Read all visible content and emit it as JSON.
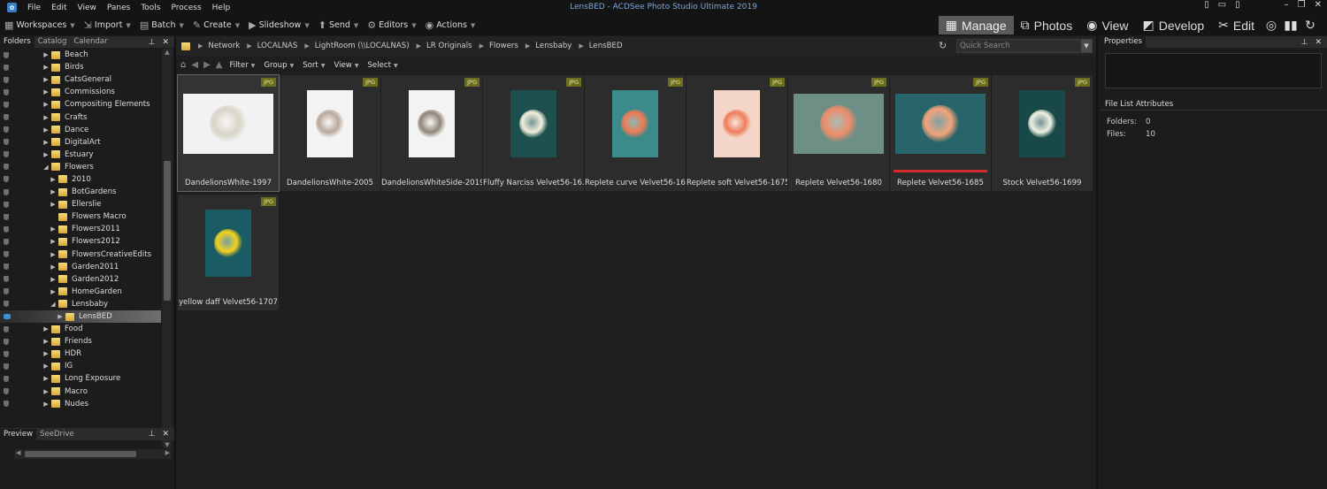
{
  "app": {
    "title": "LensBED - ACDSee Photo Studio Ultimate 2019",
    "menu": [
      "File",
      "Edit",
      "View",
      "Panes",
      "Tools",
      "Process",
      "Help"
    ]
  },
  "toolbar": {
    "items": [
      {
        "label": "Workspaces",
        "icon": "grid-icon"
      },
      {
        "label": "Import",
        "icon": "import-icon"
      },
      {
        "label": "Batch",
        "icon": "batch-icon"
      },
      {
        "label": "Create",
        "icon": "create-icon"
      },
      {
        "label": "Slideshow",
        "icon": "slideshow-icon"
      },
      {
        "label": "Send",
        "icon": "send-icon"
      },
      {
        "label": "Editors",
        "icon": "editors-icon"
      },
      {
        "label": "Actions",
        "icon": "actions-icon"
      }
    ],
    "modes": [
      {
        "label": "Manage",
        "icon": "manage-icon",
        "active": true
      },
      {
        "label": "Photos",
        "icon": "photos-icon",
        "active": false
      },
      {
        "label": "View",
        "icon": "view-icon",
        "active": false
      },
      {
        "label": "Develop",
        "icon": "develop-icon",
        "active": false
      },
      {
        "label": "Edit",
        "icon": "edit-icon",
        "active": false
      }
    ]
  },
  "left_pane": {
    "tabs": [
      "Folders",
      "Catalog",
      "Calendar"
    ],
    "folders": [
      {
        "label": "Beach",
        "depth": 0,
        "arrow": "▶",
        "selected": false
      },
      {
        "label": "Birds",
        "depth": 0,
        "arrow": "▶",
        "selected": false
      },
      {
        "label": "CatsGeneral",
        "depth": 0,
        "arrow": "▶",
        "selected": false
      },
      {
        "label": "Commissions",
        "depth": 0,
        "arrow": "▶",
        "selected": false
      },
      {
        "label": "Compositing Elements",
        "depth": 0,
        "arrow": "▶",
        "selected": false
      },
      {
        "label": "Crafts",
        "depth": 0,
        "arrow": "▶",
        "selected": false
      },
      {
        "label": "Dance",
        "depth": 0,
        "arrow": "▶",
        "selected": false
      },
      {
        "label": "DigitalArt",
        "depth": 0,
        "arrow": "▶",
        "selected": false
      },
      {
        "label": "Estuary",
        "depth": 0,
        "arrow": "▶",
        "selected": false
      },
      {
        "label": "Flowers",
        "depth": 0,
        "arrow": "◢",
        "selected": false
      },
      {
        "label": "2010",
        "depth": 1,
        "arrow": "▶",
        "selected": false
      },
      {
        "label": "BotGardens",
        "depth": 1,
        "arrow": "▶",
        "selected": false
      },
      {
        "label": "Ellerslie",
        "depth": 1,
        "arrow": "▶",
        "selected": false
      },
      {
        "label": "Flowers Macro",
        "depth": 1,
        "arrow": "",
        "selected": false
      },
      {
        "label": "Flowers2011",
        "depth": 1,
        "arrow": "▶",
        "selected": false
      },
      {
        "label": "Flowers2012",
        "depth": 1,
        "arrow": "▶",
        "selected": false
      },
      {
        "label": "FlowersCreativeEdits",
        "depth": 1,
        "arrow": "▶",
        "selected": false
      },
      {
        "label": "Garden2011",
        "depth": 1,
        "arrow": "▶",
        "selected": false
      },
      {
        "label": "Garden2012",
        "depth": 1,
        "arrow": "▶",
        "selected": false
      },
      {
        "label": "HomeGarden",
        "depth": 1,
        "arrow": "▶",
        "selected": false
      },
      {
        "label": "Lensbaby",
        "depth": 1,
        "arrow": "◢",
        "selected": false
      },
      {
        "label": "LensBED",
        "depth": 2,
        "arrow": "▶",
        "selected": true
      },
      {
        "label": "Food",
        "depth": 0,
        "arrow": "▶",
        "selected": false
      },
      {
        "label": "Friends",
        "depth": 0,
        "arrow": "▶",
        "selected": false
      },
      {
        "label": "HDR",
        "depth": 0,
        "arrow": "▶",
        "selected": false
      },
      {
        "label": "IG",
        "depth": 0,
        "arrow": "▶",
        "selected": false
      },
      {
        "label": "Long Exposure",
        "depth": 0,
        "arrow": "▶",
        "selected": false
      },
      {
        "label": "Macro",
        "depth": 0,
        "arrow": "▶",
        "selected": false
      },
      {
        "label": "Nudes",
        "depth": 0,
        "arrow": "▶",
        "selected": false
      }
    ],
    "preview_tabs": [
      "Preview",
      "SeeDrive"
    ]
  },
  "path_bar": {
    "crumbs": [
      "Network",
      "LOCALNAS",
      "LightRoom (\\\\LOCALNAS)",
      "LR Originals",
      "Flowers",
      "Lensbaby",
      "LensBED"
    ],
    "search_placeholder": "Quick Search"
  },
  "sub_bar": [
    "Filter",
    "Group",
    "Sort",
    "View",
    "Select"
  ],
  "thumbnails": [
    {
      "label": "DandelionsWhite-1997",
      "badge": "JPG",
      "bg": "#f2f2f2",
      "accent": "#d8d4c8",
      "kind": "landscape",
      "selected": true,
      "tagged": false
    },
    {
      "label": "DandelionsWhite-2005",
      "badge": "JPG",
      "bg": "#f4f4f4",
      "accent": "#b9a89a",
      "kind": "portrait",
      "selected": false,
      "tagged": false
    },
    {
      "label": "DandelionsWhiteSide-2019",
      "badge": "JPG",
      "bg": "#f3f3f3",
      "accent": "#8f8678",
      "kind": "portrait",
      "selected": false,
      "tagged": false
    },
    {
      "label": "Fluffy Narciss Velvet56-16...",
      "badge": "JPG",
      "bg": "#1e5050",
      "accent": "#f1f0dc",
      "kind": "portrait",
      "selected": false,
      "tagged": false
    },
    {
      "label": "Replete curve Velvet56-16...",
      "badge": "JPG",
      "bg": "#3d8a8a",
      "accent": "#f07a52",
      "kind": "portrait",
      "selected": false,
      "tagged": false
    },
    {
      "label": "Replete soft Velvet56-1675",
      "badge": "JPG",
      "bg": "#f4d6c8",
      "accent": "#ee7e5a",
      "kind": "portrait",
      "selected": false,
      "tagged": false
    },
    {
      "label": "Replete Velvet56-1680",
      "badge": "JPG",
      "bg": "#6e8f86",
      "accent": "#ef8d68",
      "kind": "landscape",
      "selected": false,
      "tagged": false
    },
    {
      "label": "Replete Velvet56-1685",
      "badge": "JPG",
      "bg": "#28656a",
      "accent": "#f3a37a",
      "kind": "landscape",
      "selected": false,
      "tagged": true
    },
    {
      "label": "Stock Velvet56-1699",
      "badge": "JPG",
      "bg": "#184848",
      "accent": "#eef2e2",
      "kind": "portrait",
      "selected": false,
      "tagged": false
    },
    {
      "label": "yellow daff Velvet56-1707",
      "badge": "JPG",
      "bg": "#1b5c64",
      "accent": "#f2d21e",
      "kind": "portrait",
      "selected": false,
      "tagged": false
    }
  ],
  "right_pane": {
    "title": "Properties",
    "section": "File List Attributes",
    "attributes": [
      {
        "label": "Folders:",
        "value": "0"
      },
      {
        "label": "Files:",
        "value": "10"
      }
    ]
  }
}
